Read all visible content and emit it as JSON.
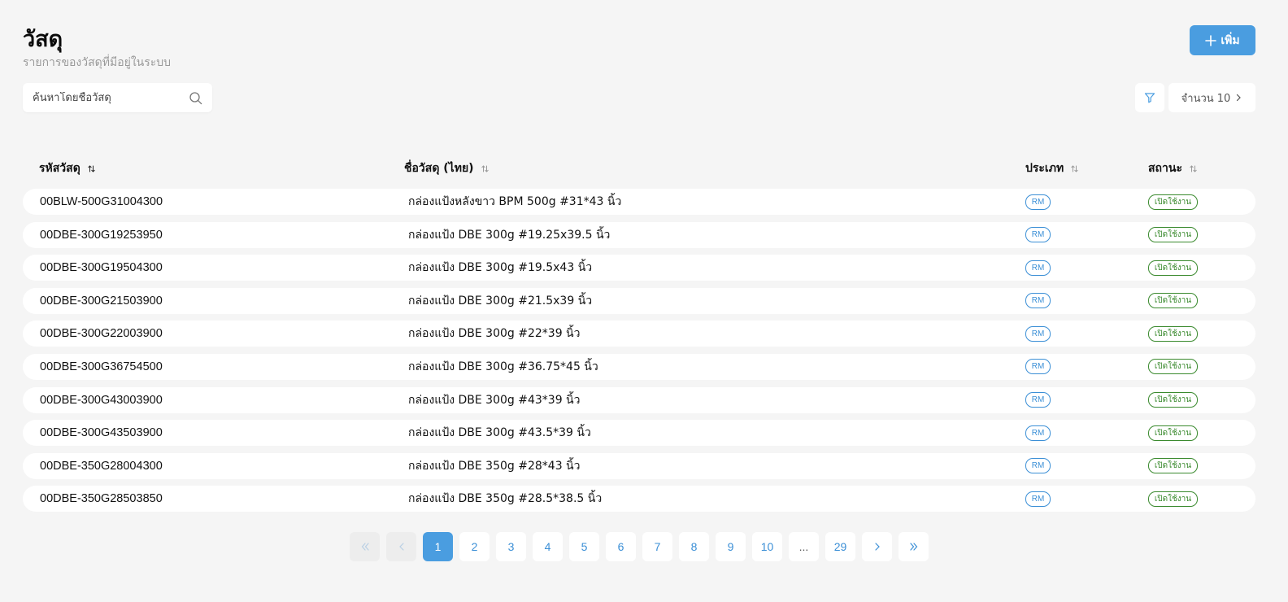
{
  "header": {
    "title": "วัสดุ",
    "subtitle": "รายการของวัสดุที่มีอยู่ในระบบ",
    "add_label": "เพิ่ม"
  },
  "toolbar": {
    "search_placeholder": "ค้นหาโดยชื่อวัสดุ",
    "page_size_label": "จำนวน 10"
  },
  "table": {
    "columns": [
      "รหัสวัสดุ",
      "ชื่อวัสดุ (ไทย)",
      "ประเภท",
      "สถานะ"
    ],
    "rows": [
      {
        "code": "00BLW-500G31004300",
        "name": "กล่องแป้งหลังขาว BPM 500g #31*43 นิ้ว",
        "type": "RM",
        "status": "เปิดใช้งาน"
      },
      {
        "code": "00DBE-300G19253950",
        "name": "กล่องแป้ง DBE 300g #19.25x39.5 นิ้ว",
        "type": "RM",
        "status": "เปิดใช้งาน"
      },
      {
        "code": "00DBE-300G19504300",
        "name": "กล่องแป้ง DBE 300g #19.5x43 นิ้ว",
        "type": "RM",
        "status": "เปิดใช้งาน"
      },
      {
        "code": "00DBE-300G21503900",
        "name": "กล่องแป้ง DBE 300g #21.5x39 นิ้ว",
        "type": "RM",
        "status": "เปิดใช้งาน"
      },
      {
        "code": "00DBE-300G22003900",
        "name": "กล่องแป้ง DBE 300g #22*39 นิ้ว",
        "type": "RM",
        "status": "เปิดใช้งาน"
      },
      {
        "code": "00DBE-300G36754500",
        "name": "กล่องแป้ง DBE 300g #36.75*45 นิ้ว",
        "type": "RM",
        "status": "เปิดใช้งาน"
      },
      {
        "code": "00DBE-300G43003900",
        "name": "กล่องแป้ง DBE 300g #43*39 นิ้ว",
        "type": "RM",
        "status": "เปิดใช้งาน"
      },
      {
        "code": "00DBE-300G43503900",
        "name": "กล่องแป้ง DBE 300g #43.5*39 นิ้ว",
        "type": "RM",
        "status": "เปิดใช้งาน"
      },
      {
        "code": "00DBE-350G28004300",
        "name": "กล่องแป้ง DBE 350g #28*43 นิ้ว",
        "type": "RM",
        "status": "เปิดใช้งาน"
      },
      {
        "code": "00DBE-350G28503850",
        "name": "กล่องแป้ง DBE 350g #28.5*38.5 นิ้ว",
        "type": "RM",
        "status": "เปิดใช้งาน"
      }
    ]
  },
  "pagination": {
    "pages": [
      "1",
      "2",
      "3",
      "4",
      "5",
      "6",
      "7",
      "8",
      "9",
      "10",
      "...",
      "29"
    ],
    "current": "1"
  },
  "colors": {
    "accent": "#4a9de0",
    "type_badge": "#3b8fd6",
    "status_active": "#3a8a2e",
    "background": "#f5f5f5"
  },
  "icons": {
    "add": "plus-icon",
    "search": "search-icon",
    "filter": "filter-icon",
    "page_size": "chevron-right-icon",
    "sort": "sort-icon",
    "first": "double-chevron-left-icon",
    "prev": "chevron-left-icon",
    "next": "chevron-right-icon",
    "last": "double-chevron-right-icon"
  }
}
